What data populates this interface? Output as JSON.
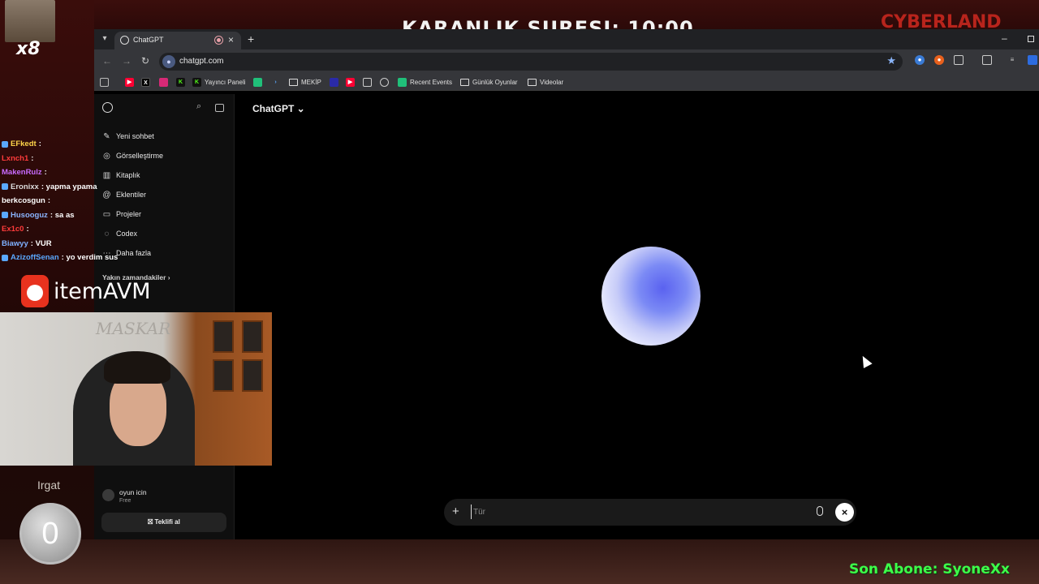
{
  "stream": {
    "game_title": "KARANLIK SURESI: 10:00",
    "game_brand": "CYBERLAND ROX",
    "emote_count": "x8",
    "chat": [
      {
        "user": "EFkedt",
        "user_color": "#ffd54a",
        "message": ""
      },
      {
        "user": "Lxnch1",
        "user_color": "#ff3b3b",
        "message": ""
      },
      {
        "user": "MakenRulz",
        "user_color": "#c86bff",
        "message": ""
      },
      {
        "user": "Eronixx",
        "user_color": "#dcdcdc",
        "message": "yapma ypama"
      },
      {
        "user": "berkcosgun",
        "user_color": "#ffffff",
        "message": ""
      },
      {
        "user": "Husooguz",
        "user_color": "#8ab4ff",
        "message": "sa as"
      },
      {
        "user": "Ex1c0",
        "user_color": "#ff3b3b",
        "message": ""
      },
      {
        "user": "Biawyy",
        "user_color": "#7fb0ff",
        "message": "VUR"
      },
      {
        "user": "AzizoffSenan",
        "user_color": "#5aa8ff",
        "message": "yo verdim sus"
      }
    ],
    "sponsor": "itemAVM",
    "webcam_watermark": "MASKAR",
    "counter_label": "Irgat",
    "counter_value": "0",
    "last_sub": "Son Abone: SyoneXx"
  },
  "browser": {
    "tab_title": "ChatGPT",
    "url": "chatgpt.com",
    "bookmarks": [
      {
        "label": "Yayıncı Paneli",
        "icon": "kick-icon",
        "color": "#53fc18"
      },
      {
        "label": "MEKİP",
        "icon": "folder-icon"
      },
      {
        "label": "Recent Events",
        "icon": "streamelements-icon",
        "color": "#20c07a"
      },
      {
        "label": "Günlük Oyunlar",
        "icon": "folder-icon"
      },
      {
        "label": "Videolar",
        "icon": "folder-icon"
      }
    ]
  },
  "chatgpt": {
    "nav": [
      {
        "label": "Yeni sohbet",
        "icon": "compose-icon"
      },
      {
        "label": "Görselleştirme",
        "icon": "images-icon"
      },
      {
        "label": "Kitaplık",
        "icon": "library-icon"
      },
      {
        "label": "Eklentiler",
        "icon": "apps-icon"
      },
      {
        "label": "Projeler",
        "icon": "folder-icon"
      },
      {
        "label": "Codex",
        "icon": "codex-icon"
      },
      {
        "label": "Daha fazla",
        "icon": "more-icon"
      }
    ],
    "recent_header": "Yakın zamandakiler",
    "user_name": "oyun icin",
    "user_plan": "Free",
    "upgrade_label": "Teklifi al",
    "model_label": "ChatGPT",
    "composer_placeholder": "Tür",
    "accent_color": "#5a62f0"
  }
}
